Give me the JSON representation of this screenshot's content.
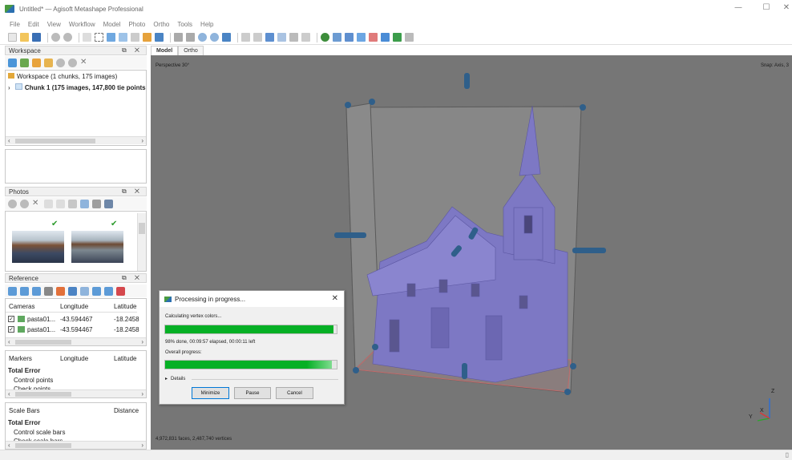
{
  "window": {
    "title": "Untitled* — Agisoft Metashape Professional",
    "minimize": "—",
    "maximize": "☐",
    "close": "✕"
  },
  "menu": [
    "File",
    "Edit",
    "View",
    "Workflow",
    "Model",
    "Photo",
    "Ortho",
    "Tools",
    "Help"
  ],
  "workspace": {
    "title": "Workspace",
    "root": "Workspace (1 chunks, 175 images)",
    "chunk": "Chunk 1 (175 images, 147,800 tie points"
  },
  "photos": {
    "title": "Photos"
  },
  "reference": {
    "title": "Reference",
    "cameras": {
      "headers": [
        "Cameras",
        "Longitude",
        "Latitude"
      ],
      "rows": [
        {
          "name": "pasta01...",
          "longitude": "-43.594467",
          "latitude": "-18.2458"
        },
        {
          "name": "pasta01...",
          "longitude": "-43.594467",
          "latitude": "-18.2458"
        }
      ]
    },
    "markers": {
      "headers": [
        "Markers",
        "Longitude",
        "Latitude"
      ],
      "rows": [
        "Total Error",
        "Control points",
        "Check points"
      ]
    },
    "scalebars": {
      "headers": [
        "Scale Bars",
        "Distance"
      ],
      "rows": [
        "Total Error",
        "Control scale bars",
        "Check scale bars"
      ]
    }
  },
  "viewport": {
    "tabs": [
      "Model",
      "Ortho"
    ],
    "perspective": "Perspective 30°",
    "snap": "Snap: Axis, 3",
    "stats": "4,972,831 faces, 2,487,740 vertices",
    "axis_z": "Z",
    "axis_x": "X",
    "axis_y": "Y"
  },
  "dialog": {
    "title": "Processing in progress...",
    "task": "Calculating vertex colors...",
    "status": "98% done, 00:09:57 elapsed, 00:00:11 left",
    "overall_label": "Overall progress:",
    "details": "Details",
    "task_progress": 0.98,
    "overall_progress": 0.97,
    "buttons": {
      "minimize": "Minimize",
      "pause": "Pause",
      "cancel": "Cancel"
    }
  },
  "colors": {
    "viewport_bg": "#767676",
    "model": "#7d78c4",
    "progress": "#06b025",
    "handles": "#2f5f8a"
  }
}
